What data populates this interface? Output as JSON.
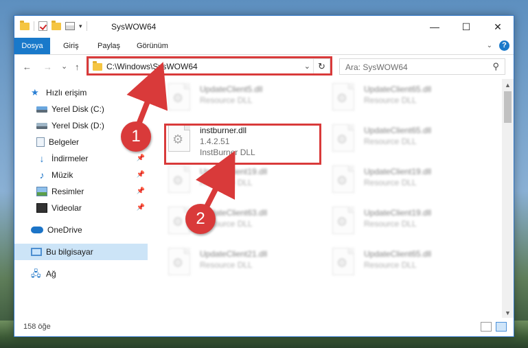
{
  "window": {
    "title": "SysWOW64",
    "controls": {
      "minimize": "—",
      "maximize": "☐",
      "close": "✕"
    }
  },
  "ribbon": {
    "tabs": [
      "Dosya",
      "Giriş",
      "Paylaş",
      "Görünüm"
    ],
    "expand": "⌄",
    "help": "?"
  },
  "navigation": {
    "back": "←",
    "forward": "→",
    "recent": "⌄",
    "up": "↑",
    "address": "C:\\Windows\\SysWOW64",
    "address_dropdown": "⌄",
    "refresh": "↻",
    "search_placeholder": "Ara: SysWOW64"
  },
  "sidebar": {
    "items": [
      {
        "label": "Hızlı erişim",
        "icon": "star-icon"
      },
      {
        "label": "Yerel Disk (C:)",
        "icon": "drive-c-icon"
      },
      {
        "label": "Yerel Disk (D:)",
        "icon": "drive-d-icon"
      },
      {
        "label": "Belgeler",
        "icon": "documents-icon"
      },
      {
        "label": "İndirmeler",
        "icon": "downloads-icon",
        "pinned": true
      },
      {
        "label": "Müzik",
        "icon": "music-icon",
        "pinned": true
      },
      {
        "label": "Resimler",
        "icon": "pictures-icon",
        "pinned": true
      },
      {
        "label": "Videolar",
        "icon": "videos-icon",
        "pinned": true
      },
      {
        "label": "OneDrive",
        "icon": "onedrive-icon"
      },
      {
        "label": "Bu bilgisayar",
        "icon": "this-pc-icon",
        "selected": true
      },
      {
        "label": "Ağ",
        "icon": "network-icon"
      }
    ]
  },
  "files": {
    "left": [
      {
        "name": "UpdateClient5.dll",
        "type": "Resource DLL"
      },
      {
        "name": "instburner.dll",
        "version": "1.4.2.51",
        "type": "InstBurner DLL",
        "highlighted": true
      },
      {
        "name": "UpdateClient19.dll",
        "type": "Resource DLL"
      },
      {
        "name": "UpdateClient63.dll",
        "type": "Resource DLL"
      },
      {
        "name": "UpdateClient21.dll",
        "type": "Resource DLL"
      }
    ],
    "right": [
      {
        "name": "UpdateClient65.dll",
        "type": "Resource DLL"
      },
      {
        "name": "UpdateClient65.dll",
        "type": "Resource DLL"
      },
      {
        "name": "UpdateClient19.dll",
        "type": "Resource DLL"
      },
      {
        "name": "UpdateClient19.dll",
        "type": "Resource DLL"
      },
      {
        "name": "UpdateClient65.dll",
        "type": "Resource DLL"
      }
    ]
  },
  "status": {
    "item_count": "158 öğe"
  },
  "annotations": {
    "step1": "1",
    "step2": "2",
    "color": "#d93a3a"
  }
}
